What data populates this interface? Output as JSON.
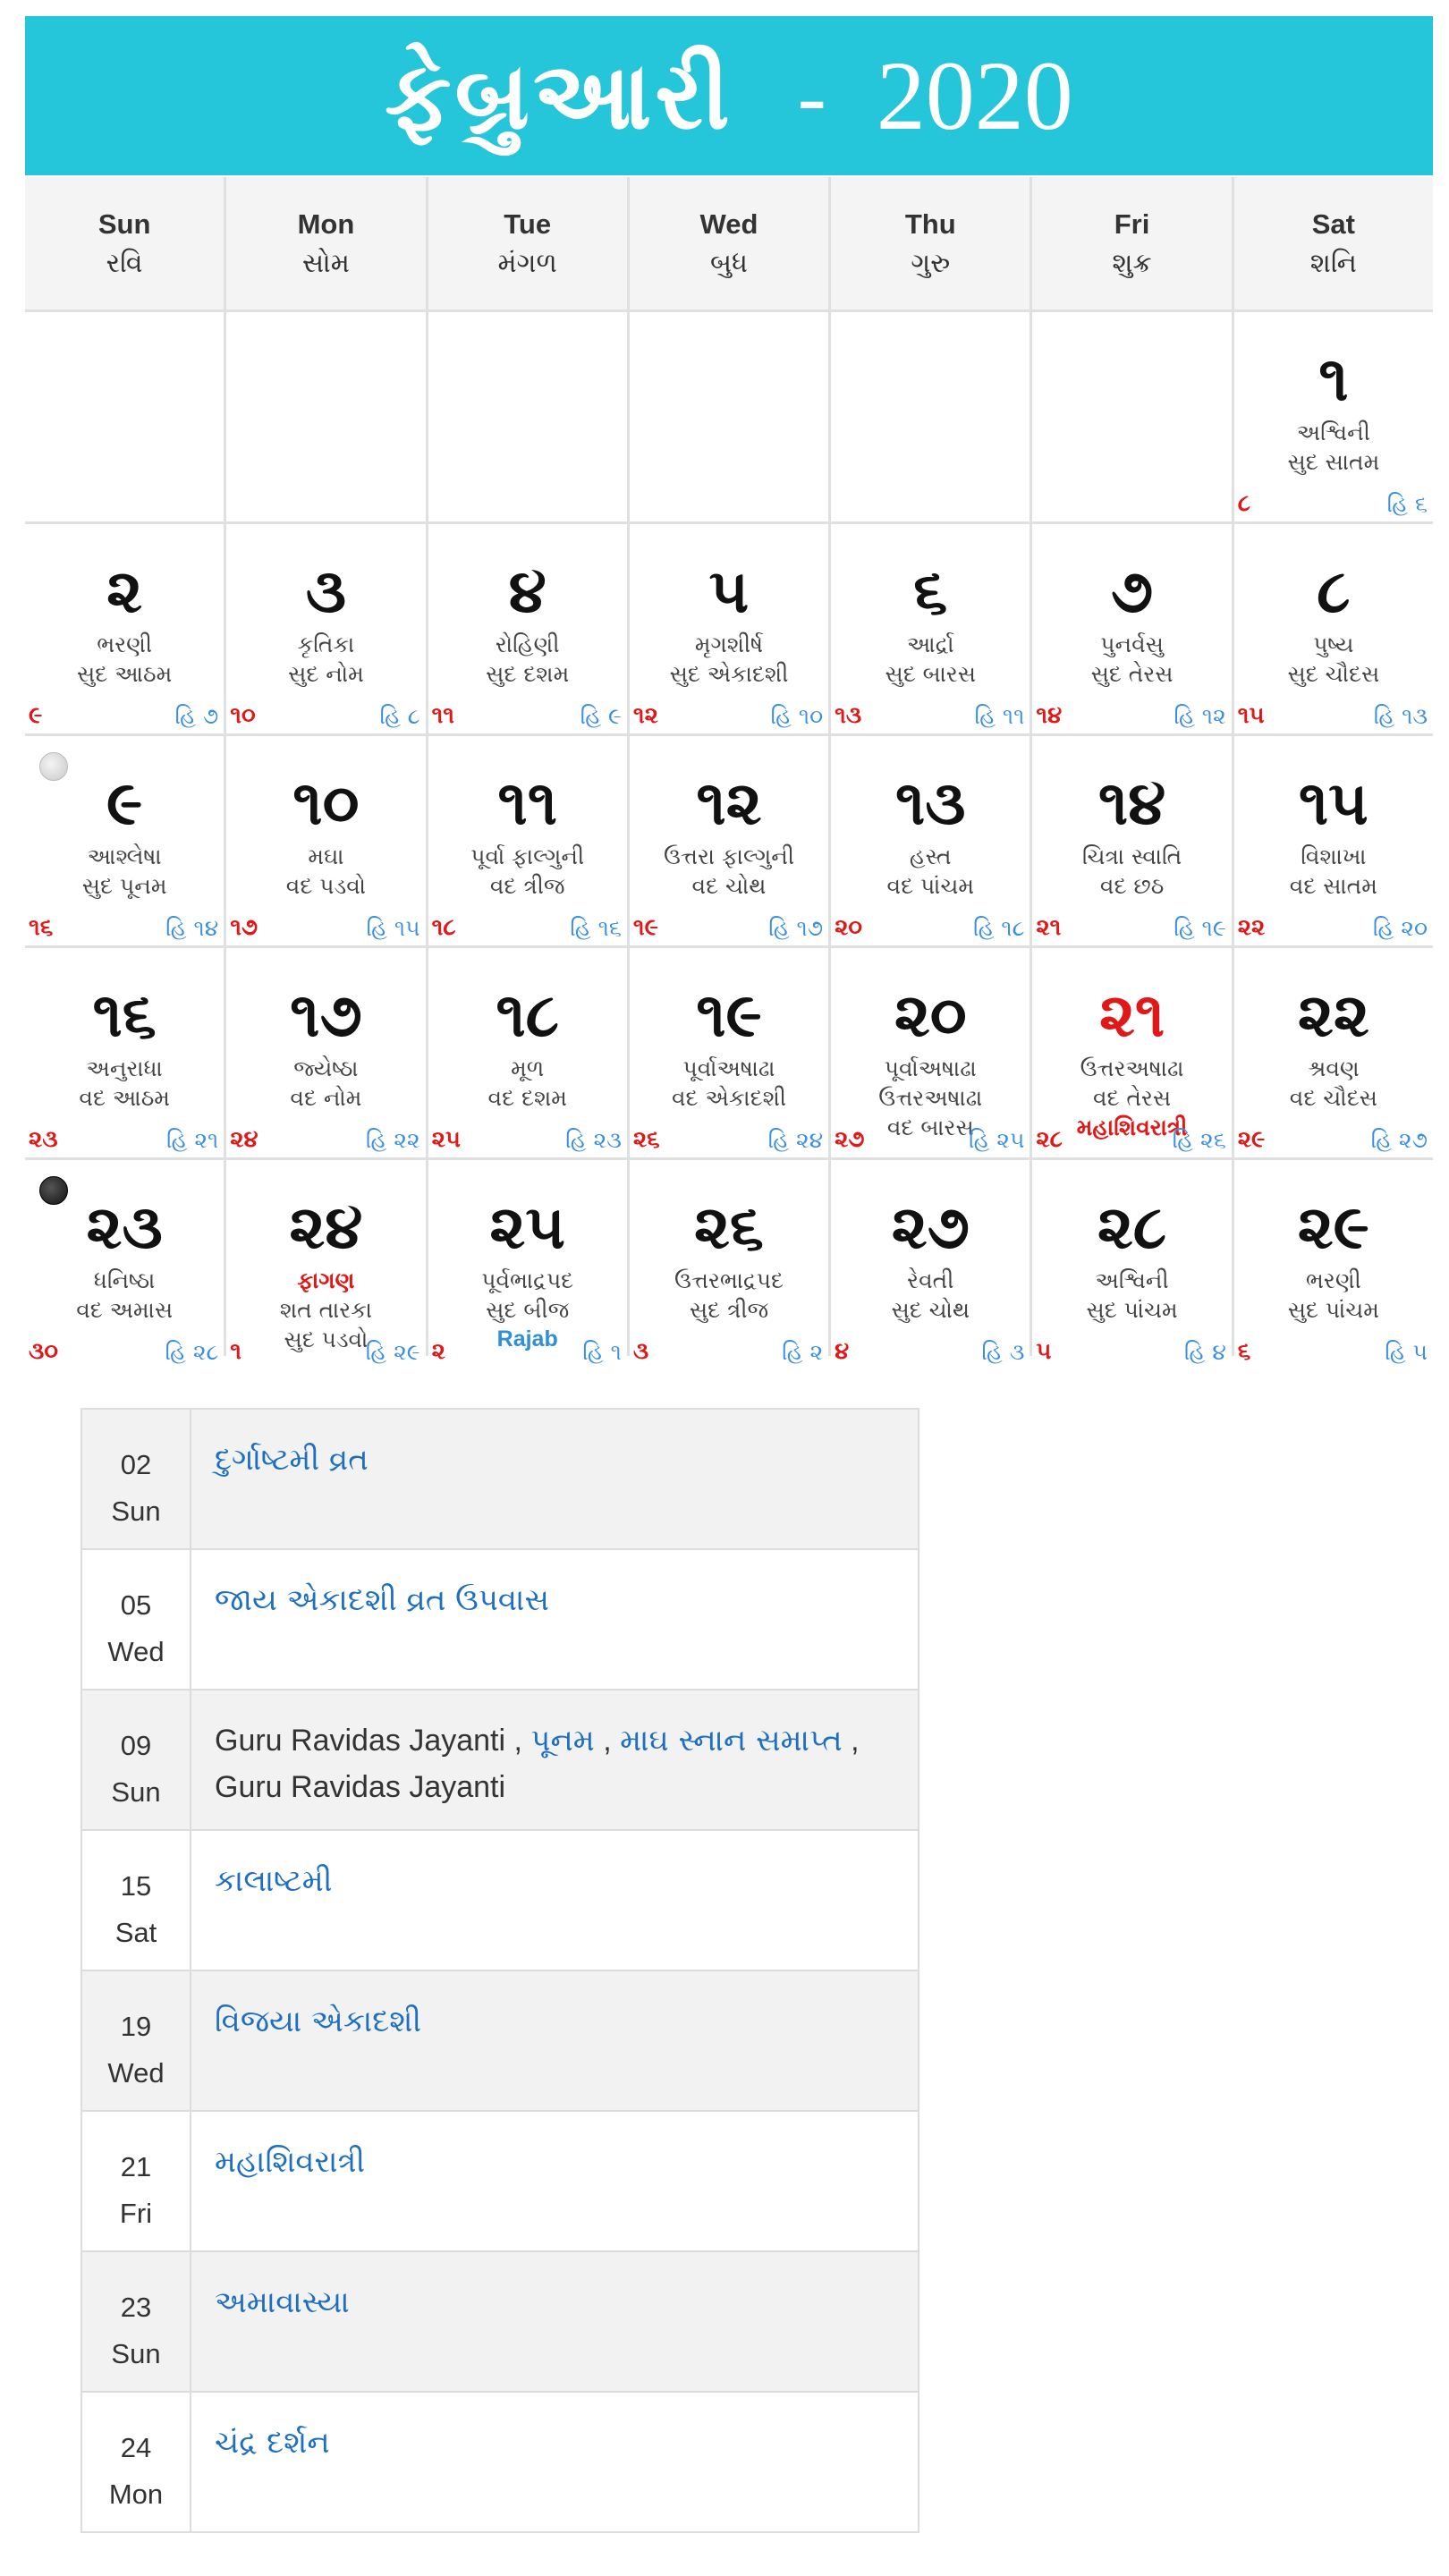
{
  "title": {
    "month": "ફેબ્રુઆરી",
    "separator": "-",
    "year": "2020"
  },
  "weekdays": [
    {
      "en": "Sun",
      "gu": "રવિ"
    },
    {
      "en": "Mon",
      "gu": "સોમ"
    },
    {
      "en": "Tue",
      "gu": "મંગળ"
    },
    {
      "en": "Wed",
      "gu": "બુધ"
    },
    {
      "en": "Thu",
      "gu": "ગુરુ"
    },
    {
      "en": "Fri",
      "gu": "શુક્ર"
    },
    {
      "en": "Sat",
      "gu": "શનિ"
    }
  ],
  "cells": [
    {
      "empty": true
    },
    {
      "empty": true
    },
    {
      "empty": true
    },
    {
      "empty": true
    },
    {
      "empty": true
    },
    {
      "empty": true
    },
    {
      "num": "૧",
      "lines": [
        "અશ્વિની",
        "સુદ સાતમ"
      ],
      "left": "૮",
      "right": "હિ ૬"
    },
    {
      "num": "૨",
      "lines": [
        "ભરણી",
        "સુદ આઠમ"
      ],
      "left": "૯",
      "right": "હિ ૭"
    },
    {
      "num": "૩",
      "lines": [
        "કૃતિકા",
        "સુદ નોમ"
      ],
      "left": "૧૦",
      "right": "હિ ૮"
    },
    {
      "num": "૪",
      "lines": [
        "રોહિણી",
        "સુદ દશમ"
      ],
      "left": "૧૧",
      "right": "હિ ૯"
    },
    {
      "num": "૫",
      "lines": [
        "મૃગશીર્ષ",
        "સુદ એકાદશી"
      ],
      "left": "૧૨",
      "right": "હિ ૧૦"
    },
    {
      "num": "૬",
      "lines": [
        "આર્દ્રા",
        "સુદ બારસ"
      ],
      "left": "૧૩",
      "right": "હિ ૧૧"
    },
    {
      "num": "૭",
      "lines": [
        "પુનર્વસુ",
        "સુદ તેરસ"
      ],
      "left": "૧૪",
      "right": "હિ ૧૨"
    },
    {
      "num": "૮",
      "lines": [
        "પુષ્ય",
        "સુદ ચૌદસ"
      ],
      "left": "૧૫",
      "right": "હિ ૧૩"
    },
    {
      "num": "૯",
      "lines": [
        "આશ્લેષા",
        "સુદ પૂનમ"
      ],
      "left": "૧૬",
      "right": "હિ ૧૪",
      "moon": "full"
    },
    {
      "num": "૧૦",
      "lines": [
        "મઘા",
        "વદ પડવો"
      ],
      "left": "૧૭",
      "right": "હિ ૧૫"
    },
    {
      "num": "૧૧",
      "lines": [
        "પૂર્વા ફાલ્ગુની",
        "વદ ત્રીજ"
      ],
      "left": "૧૮",
      "right": "હિ ૧૬"
    },
    {
      "num": "૧૨",
      "lines": [
        "ઉત્તરા ફાલ્ગુની",
        "વદ ચોથ"
      ],
      "left": "૧૯",
      "right": "હિ ૧૭"
    },
    {
      "num": "૧૩",
      "lines": [
        "હસ્ત",
        "વદ પાંચમ"
      ],
      "left": "૨૦",
      "right": "હિ ૧૮"
    },
    {
      "num": "૧૪",
      "lines": [
        "ચિત્રા સ્વાતિ",
        "વદ છઠ"
      ],
      "left": "૨૧",
      "right": "હિ ૧૯"
    },
    {
      "num": "૧૫",
      "lines": [
        "વિશાખા",
        "વદ સાતમ"
      ],
      "left": "૨૨",
      "right": "હિ ૨૦"
    },
    {
      "num": "૧૬",
      "lines": [
        "અનુરાધા",
        "વદ આઠમ"
      ],
      "left": "૨૩",
      "right": "હિ ૨૧"
    },
    {
      "num": "૧૭",
      "lines": [
        "જ્યેષ્ઠા",
        "વદ નોમ"
      ],
      "left": "૨૪",
      "right": "હિ ૨૨"
    },
    {
      "num": "૧૮",
      "lines": [
        "મૂળ",
        "વદ દશમ"
      ],
      "left": "૨૫",
      "right": "હિ ૨૩"
    },
    {
      "num": "૧૯",
      "lines": [
        "પૂર્વાઅષાઢા",
        "વદ એકાદશી"
      ],
      "left": "૨૬",
      "right": "હિ ૨૪"
    },
    {
      "num": "૨૦",
      "lines": [
        "પૂર્વાઅષાઢા",
        "ઉત્તરઅષાઢા",
        "વદ બારસ"
      ],
      "left": "૨૭",
      "right": "હિ ૨૫"
    },
    {
      "num": "૨૧",
      "red": true,
      "lines": [
        "ઉત્તરઅષાઢા",
        "વદ તેરસ"
      ],
      "red_line": "મહાશિવરાત્રી",
      "left": "૨૮",
      "right": "હિ ૨૬"
    },
    {
      "num": "૨૨",
      "lines": [
        "શ્રવણ",
        "વદ ચૌદસ"
      ],
      "left": "૨૯",
      "right": "હિ ૨૭"
    },
    {
      "num": "૨૩",
      "lines": [
        "ધનિષ્ઠા",
        "વદ અમાસ"
      ],
      "left": "૩૦",
      "right": "હિ ૨૮",
      "moon": "new"
    },
    {
      "num": "૨૪",
      "red_line_first": "ફાગણ",
      "lines": [
        "શત તારકા",
        "સુદ પડવો"
      ],
      "left": "૧",
      "right": "હિ ૨૯"
    },
    {
      "num": "૨૫",
      "lines": [
        "પૂર્વભાદ્રપદ",
        "સુદ બીજ"
      ],
      "blue_line": "Rajab",
      "left": "૨",
      "right": "હિ ૧"
    },
    {
      "num": "૨૬",
      "lines": [
        "ઉત્તરભાદ્રપદ",
        "સુદ ત્રીજ"
      ],
      "left": "૩",
      "right": "હિ ૨"
    },
    {
      "num": "૨૭",
      "lines": [
        "રેવતી",
        "સુદ ચોથ"
      ],
      "left": "૪",
      "right": "હિ ૩"
    },
    {
      "num": "૨૮",
      "lines": [
        "અશ્વિની",
        "સુદ પાંચમ"
      ],
      "left": "૫",
      "right": "હિ ૪"
    },
    {
      "num": "૨૯",
      "lines": [
        "ભરણી",
        "સુદ પાંચમ"
      ],
      "left": "૬",
      "right": "હિ ૫"
    }
  ],
  "events": [
    {
      "day": "02",
      "weekday": "Sun",
      "items": [
        {
          "text": "દુર્ગાષ્ટમી વ્રત",
          "link": true
        }
      ]
    },
    {
      "day": "05",
      "weekday": "Wed",
      "items": [
        {
          "text": "જાય એકાદશી વ્રત ઉપવાસ",
          "link": true
        }
      ]
    },
    {
      "day": "09",
      "weekday": "Sun",
      "items": [
        {
          "text": "Guru Ravidas Jayanti , ",
          "link": false
        },
        {
          "text": "પૂનમ",
          "link": true
        },
        {
          "text": " , ",
          "link": false
        },
        {
          "text": "માઘ સ્નાન સમાપ્ત",
          "link": true
        },
        {
          "text": " , Guru Ravidas Jayanti",
          "link": false
        }
      ]
    },
    {
      "day": "15",
      "weekday": "Sat",
      "items": [
        {
          "text": "કાલાષ્ટમી",
          "link": true
        }
      ]
    },
    {
      "day": "19",
      "weekday": "Wed",
      "items": [
        {
          "text": "વિજયા એકાદશી",
          "link": true
        }
      ]
    },
    {
      "day": "21",
      "weekday": "Fri",
      "items": [
        {
          "text": "મહાશિવરાત્રી",
          "link": true
        }
      ]
    },
    {
      "day": "23",
      "weekday": "Sun",
      "items": [
        {
          "text": "અમાવાસ્યા",
          "link": true
        }
      ]
    },
    {
      "day": "24",
      "weekday": "Mon",
      "items": [
        {
          "text": "ચંદ્ર દર્શન",
          "link": true
        }
      ]
    }
  ]
}
